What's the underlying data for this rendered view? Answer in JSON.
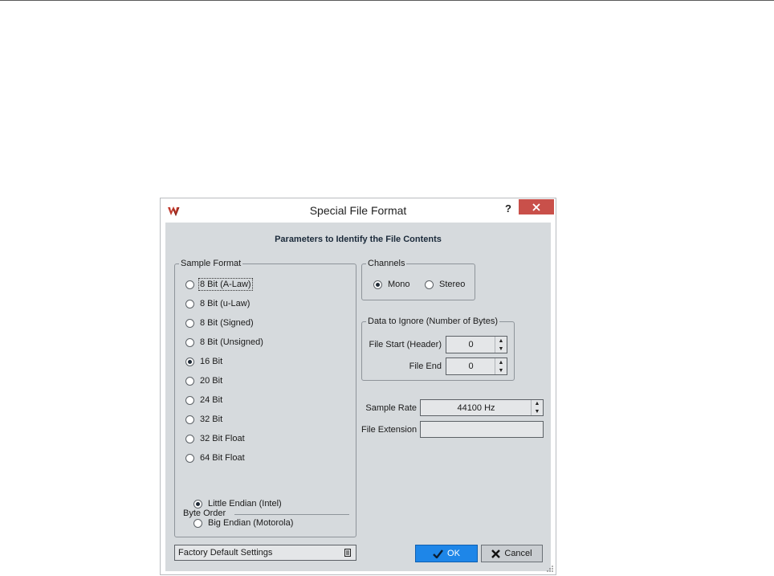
{
  "dialog": {
    "title": "Special File Format",
    "help_label": "?",
    "heading": "Parameters to Identify the File Contents"
  },
  "sample_format": {
    "label": "Sample Format",
    "options": [
      "8 Bit (A-Law)",
      "8 Bit (u-Law)",
      "8 Bit (Signed)",
      "8 Bit (Unsigned)",
      "16 Bit",
      "20 Bit",
      "24 Bit",
      "32 Bit",
      "32 Bit Float",
      "64 Bit Float"
    ],
    "selected": "16 Bit"
  },
  "byte_order": {
    "label": "Byte Order",
    "options": [
      "Little Endian (Intel)",
      "Big Endian (Motorola)"
    ],
    "selected": "Little Endian (Intel)"
  },
  "channels": {
    "label": "Channels",
    "options": [
      "Mono",
      "Stereo"
    ],
    "selected": "Mono"
  },
  "data_ignore": {
    "label": "Data to Ignore (Number of Bytes)",
    "file_start_label": "File Start (Header)",
    "file_start_value": "0",
    "file_end_label": "File End",
    "file_end_value": "0"
  },
  "sample_rate": {
    "label": "Sample Rate",
    "value": "44100 Hz"
  },
  "file_extension": {
    "label": "File Extension",
    "value": ""
  },
  "preset": {
    "value": "Factory Default Settings"
  },
  "buttons": {
    "ok": "OK",
    "cancel": "Cancel"
  },
  "colors": {
    "accent": "#1e86e8",
    "close": "#c9504a",
    "panel": "#d6dadd"
  }
}
